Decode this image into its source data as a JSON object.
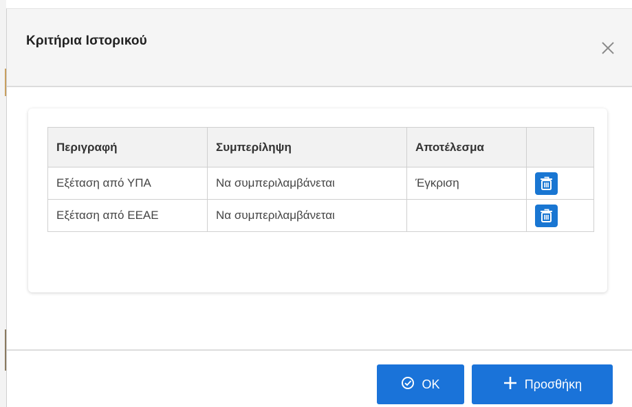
{
  "dialog": {
    "title": "Κριτήρια Ιστορικού",
    "close_icon": "close-icon"
  },
  "table": {
    "columns": [
      "Περιγραφή",
      "Συμπερίληψη",
      "Αποτέλεσμα",
      ""
    ],
    "rows": [
      {
        "description": "Εξέταση από ΥΠΑ",
        "inclusion": "Να συμπεριλαμβάνεται",
        "result": "Έγκριση",
        "action_icon": "trash-icon"
      },
      {
        "description": "Εξέταση από ΕΕΑΕ",
        "inclusion": "Να συμπεριλαμβάνεται",
        "result": "",
        "action_icon": "trash-icon"
      }
    ]
  },
  "footer": {
    "ok_label": "OK",
    "ok_icon": "check-circle-icon",
    "add_label": "Προσθήκη",
    "add_icon": "plus-icon"
  },
  "colors": {
    "primary": "#1a73d9",
    "header_bg": "#f5f5f5",
    "table_header_bg": "#f2f2f2",
    "border": "#cfcfcf"
  }
}
